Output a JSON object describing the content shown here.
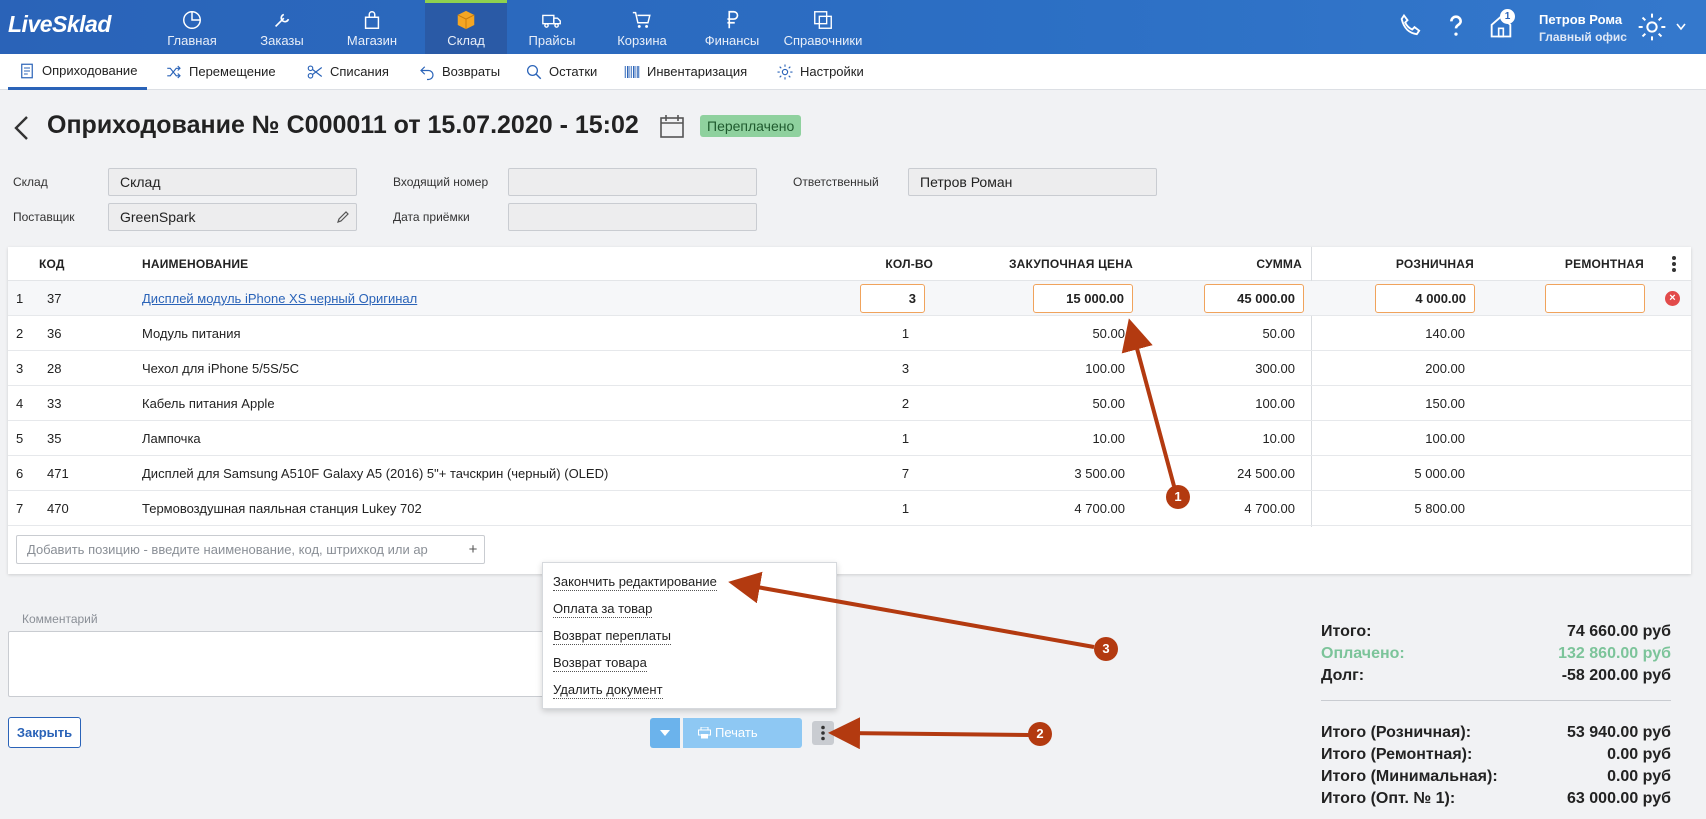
{
  "app": {
    "logo": "LiveSklad"
  },
  "nav": {
    "items": [
      {
        "label": "Главная",
        "icon": "pie-chart-icon"
      },
      {
        "label": "Заказы",
        "icon": "wrench-icon"
      },
      {
        "label": "Магазин",
        "icon": "shopping-bag-icon"
      },
      {
        "label": "Склад",
        "icon": "box-icon"
      },
      {
        "label": "Прайсы",
        "icon": "truck-icon"
      },
      {
        "label": "Корзина",
        "icon": "cart-icon"
      },
      {
        "label": "Финансы",
        "icon": "ruble-icon"
      },
      {
        "label": "Справочники",
        "icon": "copy-icon"
      }
    ],
    "badge": "1"
  },
  "user": {
    "name": "Петров Рома",
    "office": "Главный офис"
  },
  "subnav": {
    "items": [
      {
        "label": "Оприходование",
        "icon": "document-icon"
      },
      {
        "label": "Перемещение",
        "icon": "shuffle-icon"
      },
      {
        "label": "Списания",
        "icon": "scissors-icon"
      },
      {
        "label": "Возвраты",
        "icon": "return-icon"
      },
      {
        "label": "Остатки",
        "icon": "search-icon"
      },
      {
        "label": "Инвентаризация",
        "icon": "barcode-icon"
      },
      {
        "label": "Настройки",
        "icon": "gear-icon"
      }
    ]
  },
  "doc": {
    "title": "Оприходование № C000011 от 15.07.2020 - 15:02",
    "status": "Переплачено"
  },
  "form": {
    "warehouse_label": "Склад",
    "warehouse_value": "Склад",
    "supplier_label": "Поставщик",
    "supplier_value": "GreenSpark",
    "incoming_label": "Входящий номер",
    "incoming_value": "",
    "date_label": "Дата приёмки",
    "date_value": "",
    "responsible_label": "Ответственный",
    "responsible_value": "Петров Роман"
  },
  "table": {
    "headers": {
      "code": "КОД",
      "name": "НАИМЕНОВАНИЕ",
      "qty": "КОЛ-ВО",
      "purchase": "ЗАКУПОЧНАЯ ЦЕНА",
      "sum": "СУММА",
      "retail": "РОЗНИЧНАЯ",
      "repair": "РЕМОНТНАЯ"
    },
    "rows": [
      {
        "n": "1",
        "code": "37",
        "name": "Дисплей модуль iPhone XS черный Оригинал",
        "qty": "3",
        "purchase": "15 000.00",
        "sum": "45 000.00",
        "retail": "4 000.00",
        "repair": ""
      },
      {
        "n": "2",
        "code": "36",
        "name": "Модуль питания",
        "qty": "1",
        "purchase": "50.00",
        "sum": "50.00",
        "retail": "140.00",
        "repair": ""
      },
      {
        "n": "3",
        "code": "28",
        "name": "Чехол для iPhone 5/5S/5C",
        "qty": "3",
        "purchase": "100.00",
        "sum": "300.00",
        "retail": "200.00",
        "repair": ""
      },
      {
        "n": "4",
        "code": "33",
        "name": "Кабель питания Apple",
        "qty": "2",
        "purchase": "50.00",
        "sum": "100.00",
        "retail": "150.00",
        "repair": ""
      },
      {
        "n": "5",
        "code": "35",
        "name": "Лампочка",
        "qty": "1",
        "purchase": "10.00",
        "sum": "10.00",
        "retail": "100.00",
        "repair": ""
      },
      {
        "n": "6",
        "code": "471",
        "name": "Дисплей для Samsung A510F Galaxy A5 (2016) 5\"+ тачскрин (черный) (OLED)",
        "qty": "7",
        "purchase": "3 500.00",
        "sum": "24 500.00",
        "retail": "5 000.00",
        "repair": ""
      },
      {
        "n": "7",
        "code": "470",
        "name": "Термовоздушная паяльная станция Lukey 702",
        "qty": "1",
        "purchase": "4 700.00",
        "sum": "4 700.00",
        "retail": "5 800.00",
        "repair": ""
      }
    ],
    "add_placeholder": "Добавить позицию - введите наименование, код, штрихкод или ар",
    "add_plus": "+"
  },
  "comment": {
    "label": "Комментарий"
  },
  "menu": {
    "items": [
      "Закончить редактирование",
      "Оплата за товар",
      "Возврат переплаты",
      "Возврат товара",
      "Удалить документ"
    ]
  },
  "buttons": {
    "close": "Закрыть",
    "print": "Печать"
  },
  "totals": {
    "total_label": "Итого:",
    "total_value": "74 660.00 руб",
    "paid_label": "Оплачено:",
    "paid_value": "132 860.00 руб",
    "debt_label": "Долг:",
    "debt_value": "-58 200.00 руб",
    "retail_label": "Итого (Розничная):",
    "retail_value": "53 940.00 руб",
    "repair_label": "Итого (Ремонтная):",
    "repair_value": "0.00 руб",
    "min_label": "Итого (Минимальная):",
    "min_value": "0.00 руб",
    "opt_label": "Итого (Опт. № 1):",
    "opt_value": "63 000.00 руб"
  },
  "annotations": {
    "one": "1",
    "two": "2",
    "three": "3"
  },
  "colors": {
    "brand": "#2a63b8",
    "accent_green": "#8fd14f",
    "status_bg": "#8fd19e",
    "input_highlight": "#f0a35c",
    "annotation": "#b33a10"
  }
}
